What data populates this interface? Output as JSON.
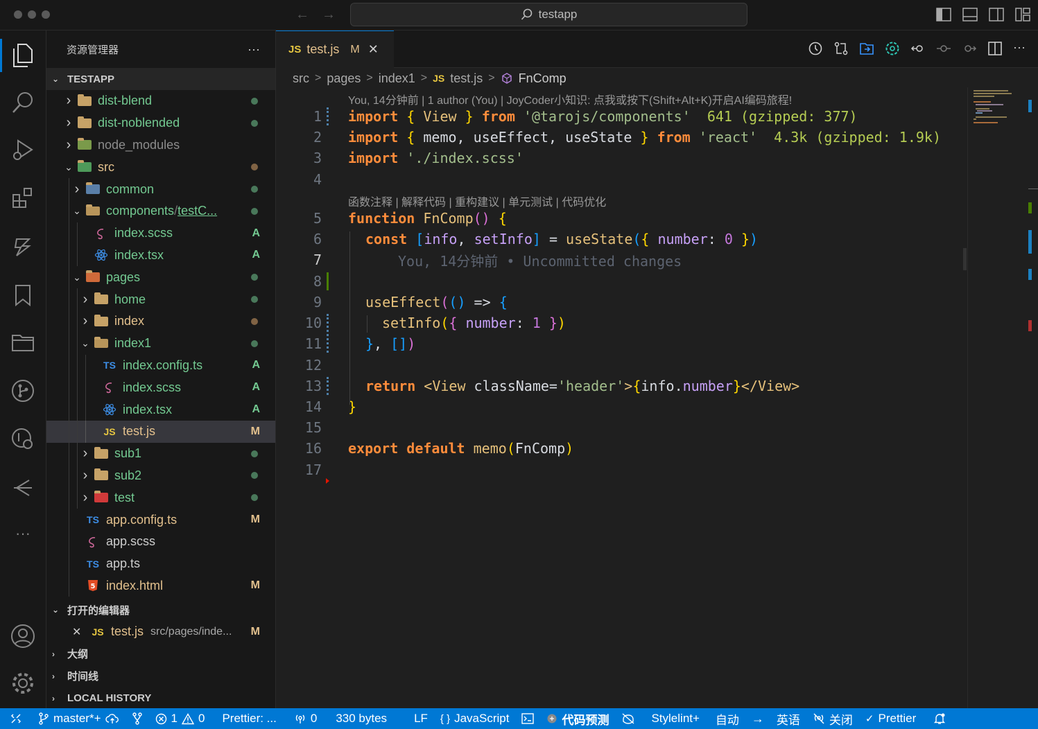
{
  "window": {
    "search_text": "testapp"
  },
  "activity_bar": {
    "icons": [
      "explorer-icon",
      "search-icon",
      "run-debug-icon",
      "extensions-icon",
      "ai-assistant-icon",
      "bookmark-icon",
      "folder-icon",
      "git-graph-icon",
      "remote-icon",
      "timeline-icon",
      "more-icon",
      "account-icon",
      "gear-icon"
    ]
  },
  "sidebar": {
    "title": "资源管理器",
    "more": "···",
    "root": "TESTAPP",
    "tree": [
      {
        "label": "dist-blend",
        "depth": 0,
        "type": "folder",
        "expanded": false,
        "status": "dot"
      },
      {
        "label": "dist-noblended",
        "depth": 0,
        "type": "folder",
        "expanded": false,
        "status": "dot"
      },
      {
        "label": "node_modules",
        "depth": 0,
        "type": "node",
        "expanded": false,
        "status": ""
      },
      {
        "label": "src",
        "depth": 0,
        "type": "src",
        "expanded": true,
        "status": "dot-brown"
      },
      {
        "label": "common",
        "depth": 1,
        "type": "common",
        "expanded": false,
        "status": "dot"
      },
      {
        "label": "components",
        "label_suffix": "/",
        "label_extra": "testC...",
        "depth": 1,
        "type": "folder-open",
        "expanded": true,
        "status": "dot"
      },
      {
        "label": "index.scss",
        "depth": 2,
        "type": "scss",
        "status": "A"
      },
      {
        "label": "index.tsx",
        "depth": 2,
        "type": "react",
        "status": "A"
      },
      {
        "label": "pages",
        "depth": 1,
        "type": "pages",
        "expanded": true,
        "status": "dot"
      },
      {
        "label": "home",
        "depth": 2,
        "type": "folder",
        "expanded": false,
        "status": "dot"
      },
      {
        "label": "index",
        "depth": 2,
        "type": "folder",
        "expanded": false,
        "status": "dot-brown"
      },
      {
        "label": "index1",
        "depth": 2,
        "type": "folder-open",
        "expanded": true,
        "status": "dot"
      },
      {
        "label": "index.config.ts",
        "depth": 3,
        "type": "ts",
        "status": "A"
      },
      {
        "label": "index.scss",
        "depth": 3,
        "type": "scss",
        "status": "A"
      },
      {
        "label": "index.tsx",
        "depth": 3,
        "type": "react",
        "status": "A"
      },
      {
        "label": "test.js",
        "depth": 3,
        "type": "js",
        "status": "M",
        "selected": true
      },
      {
        "label": "sub1",
        "depth": 2,
        "type": "folder",
        "expanded": false,
        "status": "dot"
      },
      {
        "label": "sub2",
        "depth": 2,
        "type": "folder",
        "expanded": false,
        "status": "dot"
      },
      {
        "label": "test",
        "depth": 2,
        "type": "test",
        "expanded": false,
        "status": "dot"
      },
      {
        "label": "app.config.ts",
        "depth": 1,
        "type": "ts",
        "status": "M"
      },
      {
        "label": "app.scss",
        "depth": 1,
        "type": "scss",
        "status": ""
      },
      {
        "label": "app.ts",
        "depth": 1,
        "type": "ts",
        "status": ""
      },
      {
        "label": "index.html",
        "depth": 1,
        "type": "html",
        "status": "M"
      }
    ],
    "open_editors": {
      "title": "打开的编辑器",
      "close": "✕",
      "file_icon": "JS",
      "file": "test.js",
      "path": "src/pages/inde...",
      "status": "M"
    },
    "outline": "大纲",
    "timeline": "时间线",
    "local_history": "LOCAL HISTORY"
  },
  "tab": {
    "icon": "JS",
    "name": "test.js",
    "status": "M",
    "close": "✕"
  },
  "breadcrumb": {
    "items": [
      "src",
      "pages",
      "index1"
    ],
    "file_icon": "JS",
    "file": "test.js",
    "symbol": "FnComp",
    "sep": ">"
  },
  "editor": {
    "codelens_top": "You, 14分钟前 | 1 author (You) | JoyCoder小知识: 点我或按下(Shift+Alt+K)开启AI编码旅程!",
    "codelens_fn": "函数注释 | 解释代码 | 重构建议 | 单元测试 | 代码优化",
    "line_numbers": [
      "1",
      "2",
      "3",
      "4",
      "5",
      "6",
      "7",
      "8",
      "9",
      "10",
      "11",
      "12",
      "13",
      "14",
      "15",
      "16",
      "17"
    ],
    "line1": {
      "kw": "import",
      "open": "{",
      "name": "View",
      "close": "}",
      "from": "from",
      "src": "'@tarojs/components'",
      "size": "641 (gzipped: 377)"
    },
    "line2": {
      "kw": "import",
      "open": "{",
      "names": "memo, useEffect, useState",
      "close": "}",
      "from": "from",
      "src": "'react'",
      "size": "4.3k (gzipped: 1.9k)"
    },
    "line3": {
      "kw": "import",
      "src": "'./index.scss'"
    },
    "line5": {
      "kw": "function",
      "name": "FnComp",
      "paren": "()",
      "brace": "{"
    },
    "line6": {
      "kw": "const",
      "lb": "[",
      "a": "info",
      "comma": ", ",
      "b": "setInfo",
      "rb": "]",
      "eq": " = ",
      "fn": "useState",
      "lp": "(",
      "ob": "{ ",
      "key": "number",
      "colon": ": ",
      "val": "0",
      "cb": " }",
      "rp": ")"
    },
    "line7_ghost": "You, 14分钟前 • Uncommitted changes",
    "line9": {
      "fn": "useEffect",
      "lp": "(",
      "args": "()",
      "arrow": " => ",
      "brace": "{"
    },
    "line10": {
      "fn": "setInfo",
      "lp": "(",
      "ob": "{ ",
      "key": "number",
      "colon": ": ",
      "val": "1",
      "cb": " }",
      "rp": ")"
    },
    "line11": {
      "close": "}",
      "comma": ", ",
      "arr": "[]",
      "rp": ")"
    },
    "line13": {
      "kw": "return",
      "open_tag": "<View",
      "attr": " className=",
      "attr_val": "'header'",
      "gt": ">",
      "lb": "{",
      "expr_a": "info",
      "dot": ".",
      "expr_b": "number",
      "rb": "}",
      "close_tag": "</View>"
    },
    "line14": {
      "close": "}"
    },
    "line16": {
      "kw1": "export",
      "kw2": "default",
      "fn": "memo",
      "lp": "(",
      "arg": "FnComp",
      "rp": ")"
    }
  },
  "statusbar": {
    "branch": "master*+",
    "errors": "1",
    "warnings": "0",
    "prettier_short": "Prettier: ...",
    "ports": "0",
    "size": "330 bytes",
    "eol": "LF",
    "lang_braces": "{ }",
    "language": "JavaScript",
    "code_predict": "代码预测",
    "stylelint": "Stylelint+",
    "auto": "自动",
    "lang_en": "英语",
    "off": "关闭",
    "prettier": "Prettier"
  },
  "colors": {
    "accent": "#0078d4",
    "added": "#73c991",
    "modified": "#e2c08d"
  }
}
